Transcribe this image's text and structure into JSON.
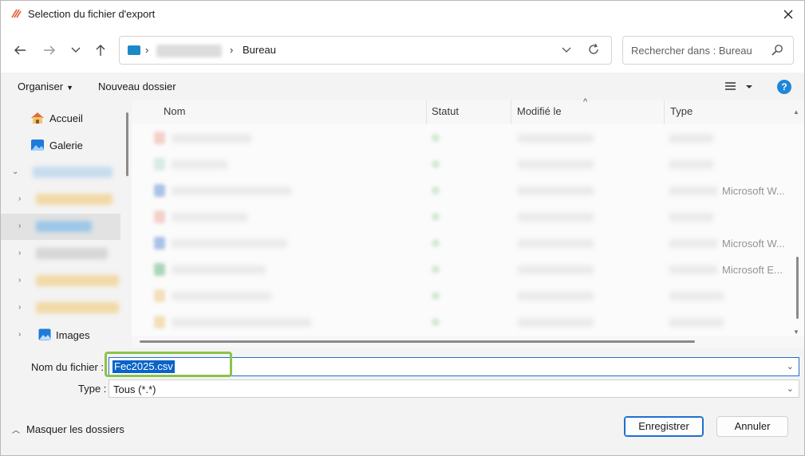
{
  "window": {
    "title": "Selection du fichier d'export"
  },
  "nav": {
    "address_current": "Bureau",
    "search_placeholder": "Rechercher dans : Bureau"
  },
  "toolbar": {
    "organize_label": "Organiser",
    "new_folder_label": "Nouveau dossier"
  },
  "sidebar": {
    "items": [
      {
        "label": "Accueil",
        "icon": "home-icon"
      },
      {
        "label": "Galerie",
        "icon": "gallery-icon"
      },
      {
        "label": "Images",
        "icon": "images-icon"
      }
    ]
  },
  "file_list": {
    "columns": [
      "Nom",
      "Statut",
      "Modifié le",
      "Type"
    ],
    "visible_type_texts": [
      "Microsoft W...",
      "Microsoft W...",
      "Microsoft E..."
    ]
  },
  "form": {
    "filename_label": "Nom du fichier :",
    "filename_value": "Fec2025.csv",
    "type_label": "Type :",
    "type_value": "Tous (*.*)"
  },
  "footer": {
    "hide_folders_label": "Masquer les dossiers",
    "save_label": "Enregistrer",
    "cancel_label": "Annuler"
  },
  "colors": {
    "accent": "#1f6fd0",
    "highlight": "#8bc34a",
    "selection": "#0a64c8"
  }
}
